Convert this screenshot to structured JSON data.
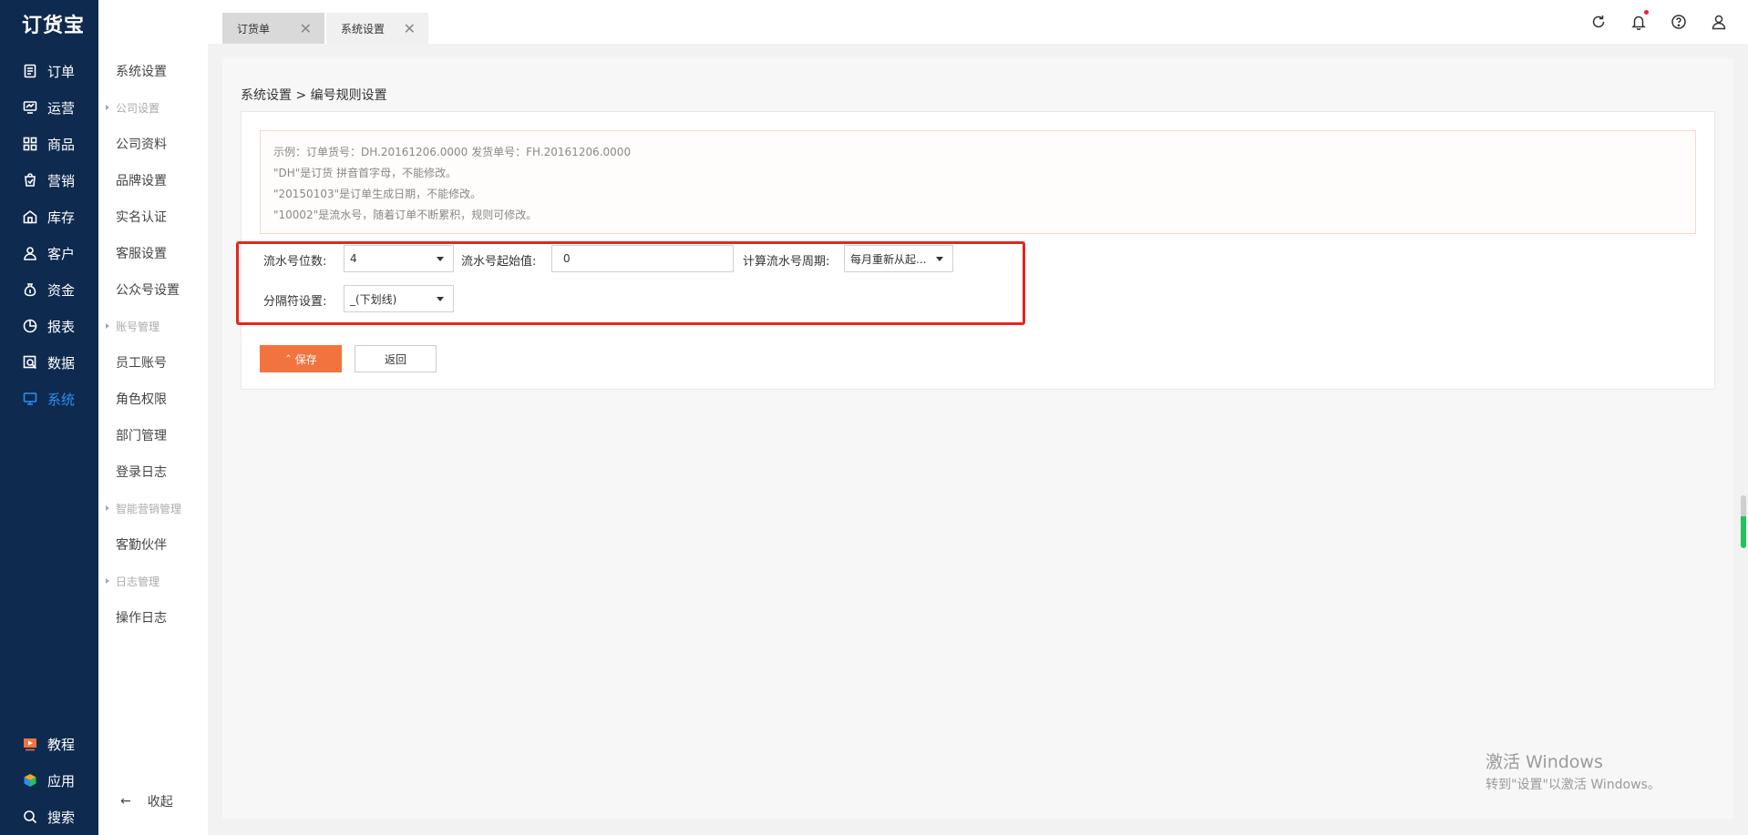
{
  "app": {
    "logo": "订货宝"
  },
  "nav": {
    "items": [
      {
        "label": "订单",
        "icon": "order-icon"
      },
      {
        "label": "运营",
        "icon": "operation-icon"
      },
      {
        "label": "商品",
        "icon": "goods-icon"
      },
      {
        "label": "营销",
        "icon": "marketing-icon"
      },
      {
        "label": "库存",
        "icon": "inventory-icon"
      },
      {
        "label": "客户",
        "icon": "customer-icon"
      },
      {
        "label": "资金",
        "icon": "money-icon"
      },
      {
        "label": "报表",
        "icon": "report-icon"
      },
      {
        "label": "数据",
        "icon": "data-icon"
      },
      {
        "label": "系统",
        "icon": "system-icon"
      }
    ],
    "bottom": [
      {
        "label": "教程",
        "icon": "tutorial-icon"
      },
      {
        "label": "应用",
        "icon": "apps-icon"
      },
      {
        "label": "搜索",
        "icon": "search-icon"
      }
    ]
  },
  "submenu": {
    "items": [
      {
        "label": "系统设置",
        "type": "item"
      },
      {
        "label": "公司设置",
        "type": "group"
      },
      {
        "label": "公司资料",
        "type": "item"
      },
      {
        "label": "品牌设置",
        "type": "item"
      },
      {
        "label": "实名认证",
        "type": "item"
      },
      {
        "label": "客服设置",
        "type": "item"
      },
      {
        "label": "公众号设置",
        "type": "item"
      },
      {
        "label": "账号管理",
        "type": "group"
      },
      {
        "label": "员工账号",
        "type": "item"
      },
      {
        "label": "角色权限",
        "type": "item"
      },
      {
        "label": "部门管理",
        "type": "item"
      },
      {
        "label": "登录日志",
        "type": "item"
      },
      {
        "label": "智能营销管理",
        "type": "group"
      },
      {
        "label": "客勤伙伴",
        "type": "item"
      },
      {
        "label": "日志管理",
        "type": "group"
      },
      {
        "label": "操作日志",
        "type": "item"
      }
    ],
    "collapse_label": "收起"
  },
  "tabs": [
    {
      "label": "订货单"
    },
    {
      "label": "系统设置"
    }
  ],
  "main": {
    "breadcrumb": "系统设置 > 编号规则设置",
    "tips": [
      "示例：订单货号：DH.20161206.0000 发货单号：FH.20161206.0000",
      "\"DH\"是订货 拼音首字母，不能修改。",
      "\"20150103\"是订单生成日期，不能修改。",
      "\"10002\"是流水号，随着订单不断累积，规则可修改。"
    ],
    "form": {
      "serial_digits_label": "流水号位数:",
      "serial_digits_value": "4",
      "serial_start_label": "流水号起始值:",
      "serial_start_value": "0",
      "cycle_label": "计算流水号周期:",
      "cycle_value": "每月重新从起...",
      "separator_label": "分隔符设置:",
      "separator_value": "_(下划线)"
    },
    "save_label": "保存",
    "back_label": "返回"
  },
  "watermark": {
    "line1": "激活 Windows",
    "line2": "转到\"设置\"以激活 Windows。"
  },
  "colors": {
    "nav_bg": "#0e2a4f",
    "active": "#2d8cf0",
    "save_btn": "#f3733f",
    "highlight": "#e5261c"
  }
}
